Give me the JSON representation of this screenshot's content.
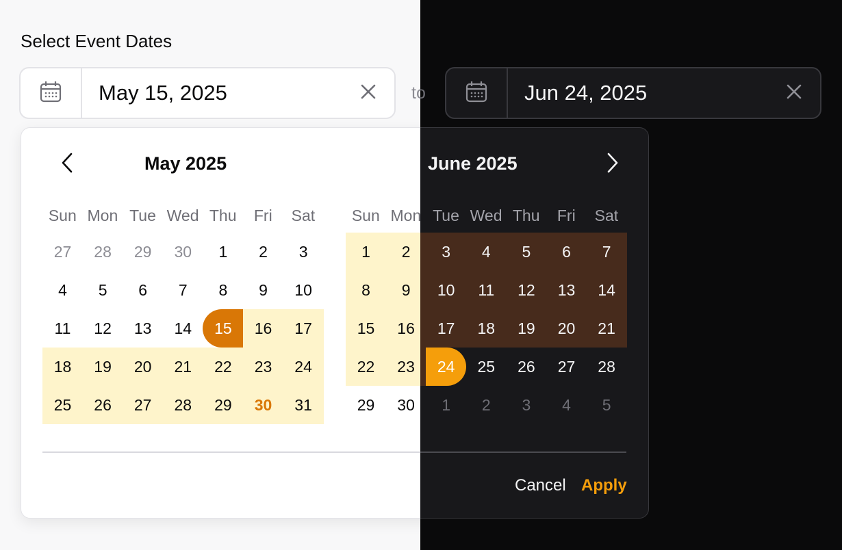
{
  "label": "Select Event Dates",
  "start_field": {
    "value": "May 15, 2025",
    "icon": "calendar-icon",
    "clear_icon": "close-icon"
  },
  "separator": "to",
  "end_field": {
    "value": "Jun 24, 2025",
    "icon": "calendar-icon",
    "clear_icon": "close-icon"
  },
  "weekdays": [
    "Sun",
    "Mon",
    "Tue",
    "Wed",
    "Thu",
    "Fri",
    "Sat"
  ],
  "months": [
    {
      "title": "May 2025",
      "weeks": [
        [
          {
            "d": "27",
            "muted": true
          },
          {
            "d": "28",
            "muted": true
          },
          {
            "d": "29",
            "muted": true
          },
          {
            "d": "30",
            "muted": true
          },
          {
            "d": "1"
          },
          {
            "d": "2"
          },
          {
            "d": "3"
          }
        ],
        [
          {
            "d": "4"
          },
          {
            "d": "5"
          },
          {
            "d": "6"
          },
          {
            "d": "7"
          },
          {
            "d": "8"
          },
          {
            "d": "9"
          },
          {
            "d": "10"
          }
        ],
        [
          {
            "d": "11"
          },
          {
            "d": "12"
          },
          {
            "d": "13"
          },
          {
            "d": "14"
          },
          {
            "d": "15",
            "start": true
          },
          {
            "d": "16",
            "range": true
          },
          {
            "d": "17",
            "range": true
          }
        ],
        [
          {
            "d": "18",
            "range": true
          },
          {
            "d": "19",
            "range": true
          },
          {
            "d": "20",
            "range": true
          },
          {
            "d": "21",
            "range": true
          },
          {
            "d": "22",
            "range": true
          },
          {
            "d": "23",
            "range": true
          },
          {
            "d": "24",
            "range": true
          }
        ],
        [
          {
            "d": "25",
            "range": true
          },
          {
            "d": "26",
            "range": true
          },
          {
            "d": "27",
            "range": true
          },
          {
            "d": "28",
            "range": true
          },
          {
            "d": "29",
            "range": true
          },
          {
            "d": "30",
            "range": true,
            "today": true
          },
          {
            "d": "31",
            "range": true
          }
        ]
      ]
    },
    {
      "title": "June 2025",
      "weeks": [
        [
          {
            "d": "1",
            "range": true
          },
          {
            "d": "2",
            "range": true
          },
          {
            "d": "3",
            "range": true
          },
          {
            "d": "4",
            "range": true
          },
          {
            "d": "5",
            "range": true
          },
          {
            "d": "6",
            "range": true
          },
          {
            "d": "7",
            "range": true
          }
        ],
        [
          {
            "d": "8",
            "range": true
          },
          {
            "d": "9",
            "range": true
          },
          {
            "d": "10",
            "range": true
          },
          {
            "d": "11",
            "range": true
          },
          {
            "d": "12",
            "range": true
          },
          {
            "d": "13",
            "range": true
          },
          {
            "d": "14",
            "range": true
          }
        ],
        [
          {
            "d": "15",
            "range": true
          },
          {
            "d": "16",
            "range": true
          },
          {
            "d": "17",
            "range": true
          },
          {
            "d": "18",
            "range": true
          },
          {
            "d": "19",
            "range": true
          },
          {
            "d": "20",
            "range": true
          },
          {
            "d": "21",
            "range": true
          }
        ],
        [
          {
            "d": "22",
            "range": true
          },
          {
            "d": "23",
            "range": true
          },
          {
            "d": "24",
            "end": true
          },
          {
            "d": "25"
          },
          {
            "d": "26"
          },
          {
            "d": "27"
          },
          {
            "d": "28"
          }
        ],
        [
          {
            "d": "29"
          },
          {
            "d": "30"
          },
          {
            "d": "1",
            "muted": true
          },
          {
            "d": "2",
            "muted": true
          },
          {
            "d": "3",
            "muted": true
          },
          {
            "d": "4",
            "muted": true
          },
          {
            "d": "5",
            "muted": true
          }
        ]
      ]
    }
  ],
  "actions": {
    "cancel": "Cancel",
    "apply": "Apply"
  },
  "colors": {
    "light_accent": "#d97706",
    "dark_accent": "#f59e0b",
    "light_range": "#fef4cb",
    "dark_range": "#472b1c"
  }
}
